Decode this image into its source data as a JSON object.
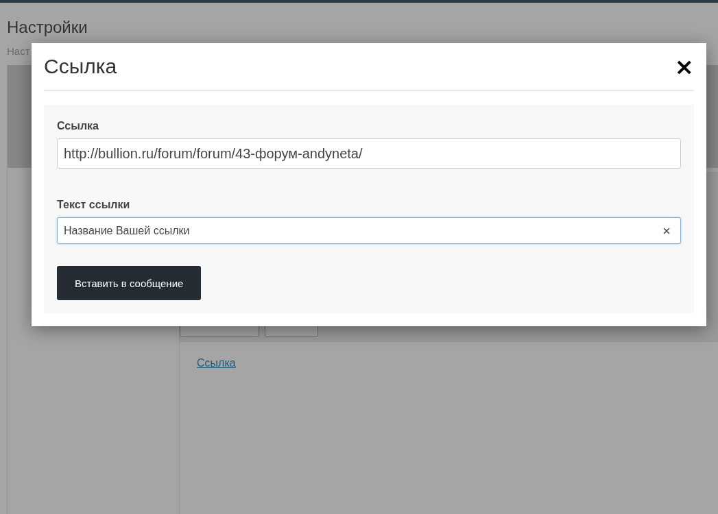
{
  "page": {
    "title": "Настройки",
    "breadcrumb": "Наст",
    "link": "Ссылка"
  },
  "dialog": {
    "title": "Ссылка",
    "close": "×",
    "fields": [
      {
        "label": "Ссылка",
        "value": "http://bullion.ru/forum/forum/43-форум-andyneta/",
        "focused": false,
        "large": true
      },
      {
        "label": "Текст ссылки",
        "value": "Название Вашей ссылки",
        "focused": true,
        "large": false
      }
    ],
    "submit": "Вставить в сообщение"
  }
}
